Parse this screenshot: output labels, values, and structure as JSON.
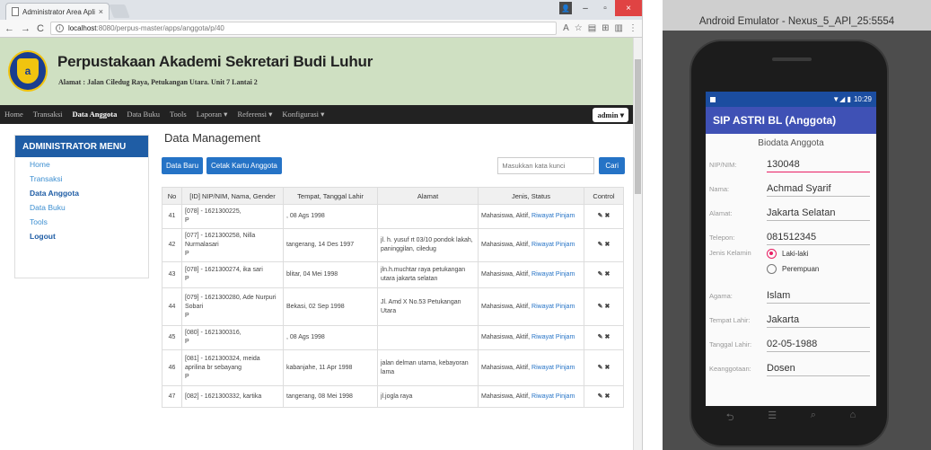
{
  "browser": {
    "tab_title": "Administrator Area Aplik",
    "tab_close": "×",
    "window_controls": {
      "user": "👤",
      "minimize": "–",
      "maximize": "▫",
      "close": "×"
    },
    "nav": {
      "back": "←",
      "forward": "→",
      "reload": "C"
    },
    "url_host": "localhost",
    "url_path": ":8080/perpus-master/apps/anggota/p/40",
    "ext_icons": [
      "A",
      "☆",
      "▤",
      "⊞",
      "▥",
      "⋮"
    ]
  },
  "site": {
    "title": "Perpustakaan Akademi Sekretari Budi Luhur",
    "address": "Alamat : Jalan Ciledug Raya, Petukangan Utara. Unit 7 Lantai 2",
    "logo_letter": "a"
  },
  "navbar": {
    "items": [
      "Home",
      "Transaksi",
      "Data Anggota",
      "Data Buku",
      "Tools",
      "Laporan ▾",
      "Referensi ▾",
      "Konfigurasi ▾"
    ],
    "active_index": 2,
    "admin_label": "admin ▾"
  },
  "sidebar": {
    "header": "ADMINISTRATOR MENU",
    "items": [
      {
        "label": "Home",
        "bold": false
      },
      {
        "label": "Transaksi",
        "bold": false
      },
      {
        "label": "Data Anggota",
        "bold": true
      },
      {
        "label": "Data Buku",
        "bold": false
      },
      {
        "label": "Tools",
        "bold": false
      },
      {
        "label": "Logout",
        "bold": true
      }
    ]
  },
  "main": {
    "page_title": "Data Management",
    "btn_new": "Data Baru",
    "btn_print": "Cetak Kartu Anggota",
    "search_placeholder": "Masukkan kata kunci",
    "search_btn": "Cari",
    "table": {
      "headers": [
        "No",
        "[ID] NIP/NIM, Nama, Gender",
        "Tempat, Tanggal Lahir",
        "Alamat",
        "Jenis, Status",
        "Control"
      ],
      "status_prefix": "Mahasiswa, Aktif, ",
      "status_link": "Riwayat Pinjam",
      "edit_icon": "✎",
      "delete_icon": "✖",
      "rows": [
        {
          "no": "41",
          "id": "[078] - 1621300225,",
          "gender": "P",
          "ttl": ", 08 Ags 1998",
          "alamat": ""
        },
        {
          "no": "42",
          "id": "[077] - 1621300258, Nilla Nurmalasari",
          "gender": "P",
          "ttl": "tangerang, 14 Des 1997",
          "alamat": "jl. h. yusuf rt 03/10 pondok lakah, paninggilan, ciledug"
        },
        {
          "no": "43",
          "id": "[078] - 1621300274, ika sari",
          "gender": "P",
          "ttl": "blitar, 04 Mei 1998",
          "alamat": "jln.h.muchtar raya petukangan utara jakarta selatan"
        },
        {
          "no": "44",
          "id": "[079] - 1621300280, Ade Nurpuri Sobari",
          "gender": "P",
          "ttl": "Bekasi, 02 Sep 1998",
          "alamat": "Jl. Amd X No.53 Petukangan Utara"
        },
        {
          "no": "45",
          "id": "[080] - 1621300316,",
          "gender": "P",
          "ttl": ", 08 Ags 1998",
          "alamat": ""
        },
        {
          "no": "46",
          "id": "[081] - 1621300324, meida aprilina br sebayang",
          "gender": "P",
          "ttl": "kabanjahe, 11 Apr 1998",
          "alamat": "jalan delman utama, kebayoran lama"
        },
        {
          "no": "47",
          "id": "[082] - 1621300332, kartika",
          "gender": "",
          "ttl": "tangerang, 08 Mei 1998",
          "alamat": "jl.jogla raya"
        }
      ]
    }
  },
  "emulator": {
    "title": "Android Emulator - Nexus_5_API_25:5554",
    "status_time": "10:29",
    "status_icons": "▼◢ ▮",
    "app_title": "SIP ASTRI BL (Anggota)",
    "section_title": "Biodata Anggota",
    "fields": [
      {
        "label": "NIP/NIM:",
        "value": "130048",
        "focus": true
      },
      {
        "label": "Nama:",
        "value": "Achmad Syarif",
        "focus": false
      },
      {
        "label": "Alamat:",
        "value": "Jakarta Selatan",
        "focus": false
      },
      {
        "label": "Telepon:",
        "value": "081512345",
        "focus": false
      }
    ],
    "gender_label": "Jenis Kelamin",
    "gender_options": [
      "Laki-laki",
      "Perempuan"
    ],
    "gender_selected": 0,
    "fields2": [
      {
        "label": "Agama:",
        "value": "Islam"
      },
      {
        "label": "Tempat Lahir:",
        "value": "Jakarta"
      },
      {
        "label": "Tanggal Lahir:",
        "value": "02-05-1988"
      },
      {
        "label": "Keanggotaan:",
        "value": "Dosen"
      }
    ],
    "navkeys": [
      "⮌",
      "☰",
      "⌕",
      "⌂"
    ]
  }
}
